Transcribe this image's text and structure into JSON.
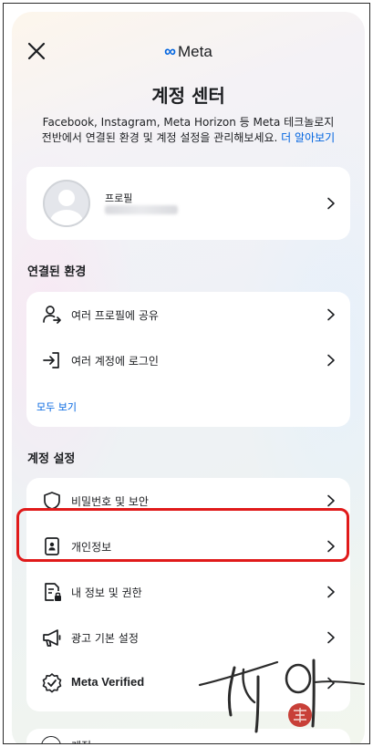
{
  "header": {
    "brand_logo_text": "Meta",
    "title": "계정 센터",
    "subtitle_line1": "Facebook, Instagram, Meta Horizon 등 Meta 테크놀로지",
    "subtitle_line2": "전반에서 연결된 환경 및 계정 설정을 관리해보세요.",
    "learn_more": "더 알아보기"
  },
  "profile": {
    "label": "프로필"
  },
  "connected": {
    "heading": "연결된 환경",
    "items": [
      {
        "label": "여러 프로필에 공유",
        "icon": "share-profile-icon"
      },
      {
        "label": "여러 계정에 로그인",
        "icon": "login-icon"
      }
    ],
    "see_all": "모두 보기"
  },
  "settings": {
    "heading": "계정 설정",
    "items": [
      {
        "label": "비밀번호 및 보안",
        "icon": "shield-icon"
      },
      {
        "label": "개인정보",
        "icon": "id-card-icon"
      },
      {
        "label": "내 정보 및 권한",
        "icon": "document-lock-icon"
      },
      {
        "label": "광고 기본 설정",
        "icon": "megaphone-icon"
      },
      {
        "label": "Meta Verified",
        "icon": "verified-badge-icon"
      }
    ],
    "partial_item": "계정"
  },
  "colors": {
    "link": "#0064e0",
    "highlight": "#e01a1a",
    "text": "#1c1e21"
  }
}
